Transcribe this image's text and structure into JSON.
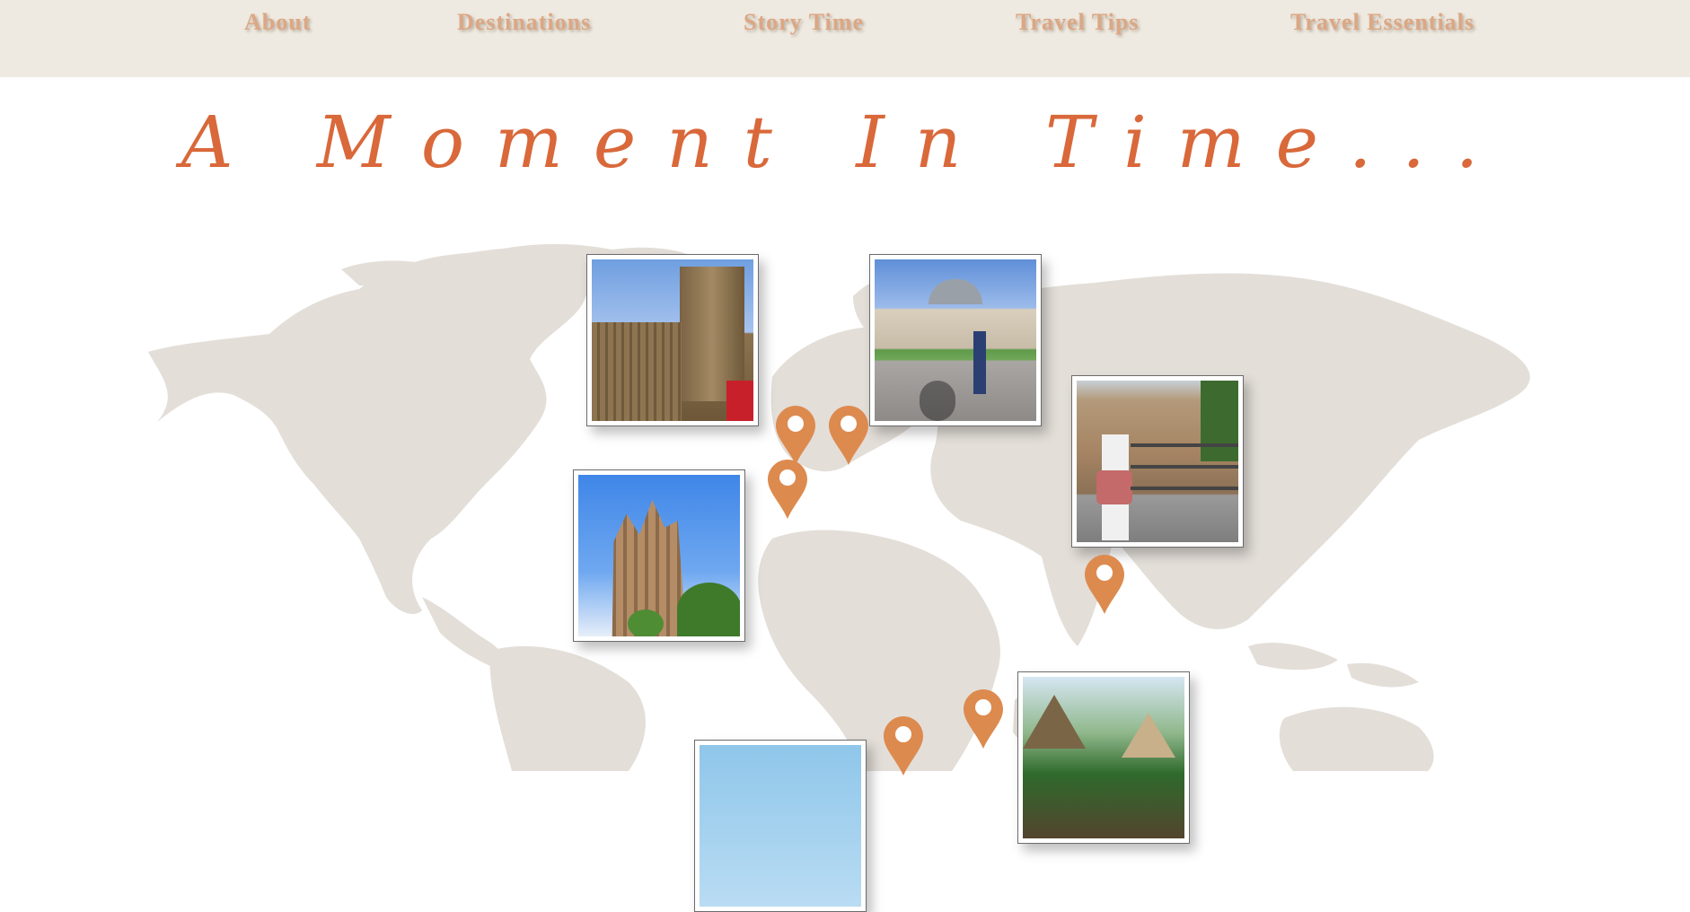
{
  "nav": {
    "items": [
      {
        "label": "About"
      },
      {
        "label": "Destinations"
      },
      {
        "label": "Story Time"
      },
      {
        "label": "Travel Tips"
      },
      {
        "label": "Travel Essentials"
      }
    ]
  },
  "hero": {
    "title": "A Moment In Time..."
  },
  "colors": {
    "nav_bg": "#efeae1",
    "nav_text": "#dca784",
    "title": "#d9683a",
    "map_land": "#e3ded8",
    "pin": "#dd8a4f"
  },
  "photos": [
    {
      "subject": "london-parliament"
    },
    {
      "subject": "berlin-reichstag"
    },
    {
      "subject": "india-cliffs-woman"
    },
    {
      "subject": "barcelona-sagrada-familia"
    },
    {
      "subject": "tropical-resort"
    },
    {
      "subject": "beach-sky"
    }
  ],
  "pins": [
    {
      "name": "london"
    },
    {
      "name": "berlin"
    },
    {
      "name": "barcelona"
    },
    {
      "name": "india"
    },
    {
      "name": "east-africa"
    },
    {
      "name": "southern-africa"
    }
  ]
}
